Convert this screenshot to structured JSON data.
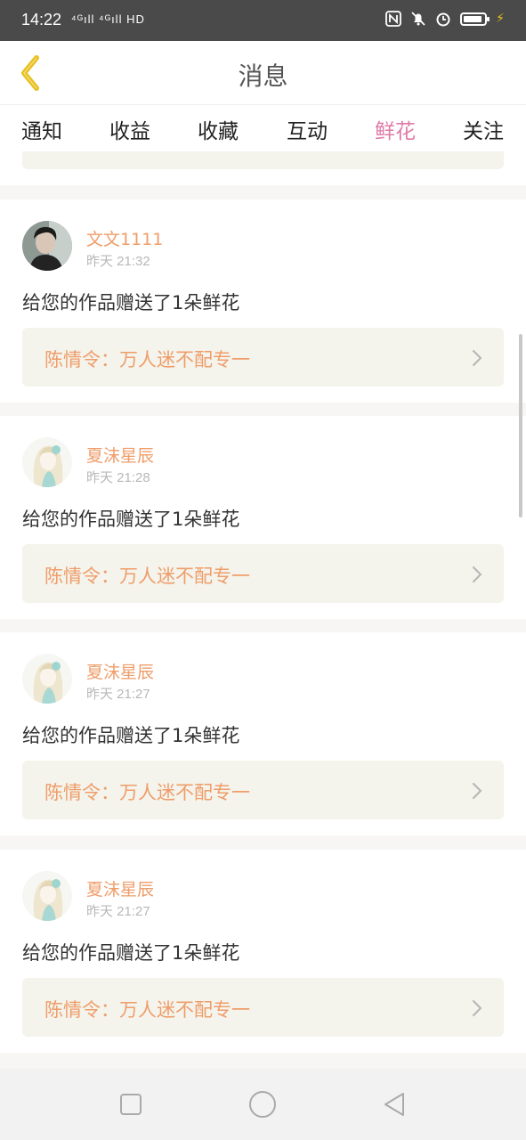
{
  "status_bar": {
    "time": "14:22",
    "signal_text": "⁴ᴳıll ⁴ᴳıll HD",
    "icons": [
      "nfc-icon",
      "mute-icon",
      "alarm-icon",
      "battery-icon",
      "charging-icon"
    ]
  },
  "header": {
    "title": "消息",
    "back_icon": "chevron-left-icon",
    "accent_color": "#e8c01e"
  },
  "tabs": [
    {
      "label": "通知",
      "active": false
    },
    {
      "label": "收益",
      "active": false
    },
    {
      "label": "收藏",
      "active": false
    },
    {
      "label": "互动",
      "active": false
    },
    {
      "label": "鲜花",
      "active": true
    },
    {
      "label": "关注",
      "active": false
    }
  ],
  "colors": {
    "active_tab": "#e07aa8",
    "username": "#ef9d6a",
    "work_title": "#ef9d6a",
    "work_box_bg": "#f4f4ec"
  },
  "messages": [
    {
      "username": "文文1111",
      "time": "昨天 21:32",
      "text": "给您的作品赠送了1朵鲜花",
      "work_title": "陈情令：万人迷不配专一",
      "avatar": "dark-avatar"
    },
    {
      "username": "夏沫星辰",
      "time": "昨天 21:28",
      "text": "给您的作品赠送了1朵鲜花",
      "work_title": "陈情令：万人迷不配专一",
      "avatar": "anime-avatar"
    },
    {
      "username": "夏沫星辰",
      "time": "昨天 21:27",
      "text": "给您的作品赠送了1朵鲜花",
      "work_title": "陈情令：万人迷不配专一",
      "avatar": "anime-avatar"
    },
    {
      "username": "夏沫星辰",
      "time": "昨天 21:27",
      "text": "给您的作品赠送了1朵鲜花",
      "work_title": "陈情令：万人迷不配专一",
      "avatar": "anime-avatar"
    }
  ],
  "nav_bar": {
    "icons": [
      "square-icon",
      "circle-icon",
      "triangle-back-icon"
    ]
  }
}
